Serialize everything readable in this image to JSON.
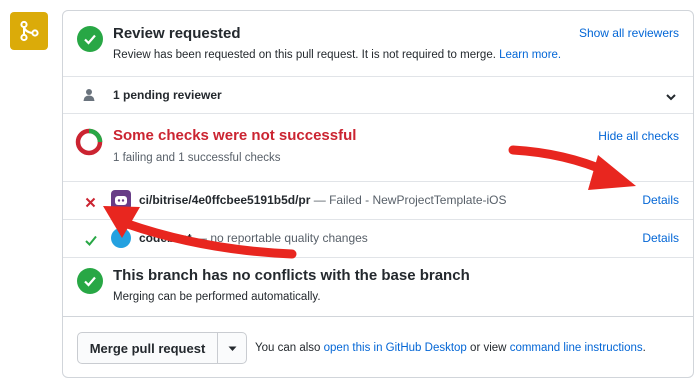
{
  "review": {
    "title": "Review requested",
    "description": "Review has been requested on this pull request. It is not required to merge.",
    "learn_more": "Learn more.",
    "show_all_reviewers": "Show all reviewers"
  },
  "pending": {
    "label": "1 pending reviewer"
  },
  "checks": {
    "title": "Some checks were not successful",
    "summary": "1 failing and 1 successful checks",
    "hide_all": "Hide all checks",
    "items": [
      {
        "name": "ci/bitrise/4e0ffcbee5191b5d/pr",
        "description": "— Failed - NewProjectTemplate-iOS",
        "status": "failed",
        "details": "Details"
      },
      {
        "name": "codebeat",
        "description": "— no reportable quality changes",
        "status": "success",
        "details": "Details"
      }
    ]
  },
  "conflicts": {
    "title": "This branch has no conflicts with the base branch",
    "description": "Merging can be performed automatically."
  },
  "merge": {
    "button_label": "Merge pull request",
    "footer_prefix": "You can also",
    "desktop_link": "open this in GitHub Desktop",
    "footer_middle": "or view",
    "cli_link": "command line instructions",
    "footer_suffix": "."
  },
  "colors": {
    "success": "#28a745",
    "failure": "#cb2431",
    "link": "#0366d6",
    "merge_icon_bg": "#dbab09",
    "annotation_arrow": "#e8261f"
  },
  "icons": {
    "merge": "git-merge-icon",
    "check": "check-icon",
    "person": "person-icon",
    "chevron": "chevron-down-icon",
    "fail": "x-icon",
    "bitrise": "bitrise-logo-icon",
    "codebeat": "codebeat-logo-icon"
  }
}
